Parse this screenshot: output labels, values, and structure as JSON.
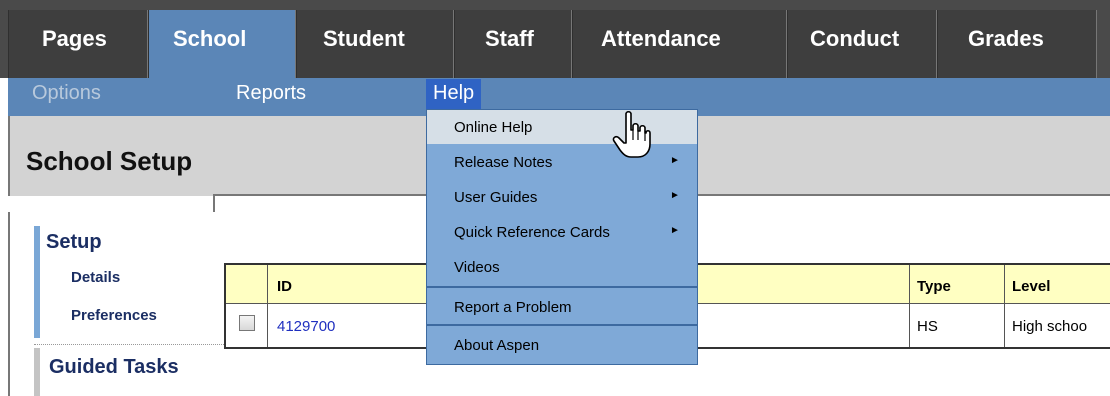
{
  "top_tabs": [
    {
      "label": "Pages"
    },
    {
      "label": "School",
      "active": true
    },
    {
      "label": "Student"
    },
    {
      "label": "Staff"
    },
    {
      "label": "Attendance"
    },
    {
      "label": "Conduct"
    },
    {
      "label": "Grades"
    }
  ],
  "sub_menu": {
    "options": "Options",
    "reports": "Reports",
    "help": "Help"
  },
  "page": {
    "title": "School Setup"
  },
  "side_nav": {
    "setup_heading": "Setup",
    "details": "Details",
    "preferences": "Preferences",
    "guided_heading": "Guided Tasks"
  },
  "table": {
    "columns": [
      "ID",
      "Type",
      "Level"
    ],
    "rows": [
      {
        "id": "4129700",
        "type": "HS",
        "level": "High schoo"
      }
    ]
  },
  "help_menu": {
    "items": [
      {
        "label": "Online Help"
      },
      {
        "label": "Release Notes",
        "submenu": true
      },
      {
        "label": "User Guides",
        "submenu": true
      },
      {
        "label": "Quick Reference Cards",
        "submenu": true
      },
      {
        "label": "Videos"
      },
      {
        "label": "Report a Problem"
      },
      {
        "label": "About Aspen"
      }
    ]
  },
  "colors": {
    "tab_bar": "#4a4a4a",
    "accent_blue": "#5b86b7",
    "menu_blue": "#7fa9d7",
    "header_yellow": "#ffffc2"
  },
  "icons": {
    "cursor": "hand-pointer-icon",
    "submenu_arrow": "arrow-right-icon"
  }
}
